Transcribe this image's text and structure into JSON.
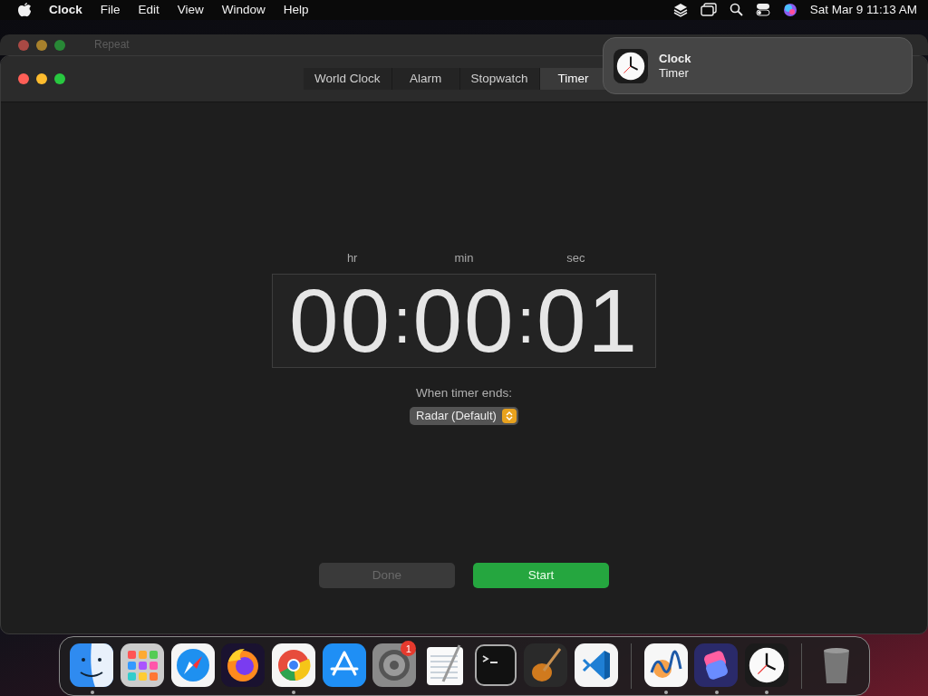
{
  "menu_bar": {
    "app": "Clock",
    "items": [
      "File",
      "Edit",
      "View",
      "Window",
      "Help"
    ],
    "clock": "Sat Mar 9  11:13 AM"
  },
  "back_window": {
    "title": "Repeat"
  },
  "tabs": [
    {
      "label": "World Clock",
      "selected": false
    },
    {
      "label": "Alarm",
      "selected": false
    },
    {
      "label": "Stopwatch",
      "selected": false
    },
    {
      "label": "Timer",
      "selected": true
    }
  ],
  "timer": {
    "separator": ":",
    "fields": [
      {
        "label": "hr",
        "value": "00"
      },
      {
        "label": "min",
        "value": "00"
      },
      {
        "label": "sec",
        "value": "01"
      }
    ]
  },
  "sound": {
    "label": "When timer ends:",
    "value": "Radar (Default)"
  },
  "buttons": [
    {
      "label": "Done",
      "disabled": true,
      "kind": "secondary"
    },
    {
      "label": "Start",
      "disabled": false,
      "kind": "primary"
    }
  ],
  "notification": {
    "title": "Clock",
    "body": "Timer"
  },
  "dock": [
    {
      "kind": "finder",
      "running": true
    },
    {
      "kind": "launchpad",
      "running": false
    },
    {
      "kind": "safari",
      "running": false
    },
    {
      "kind": "firefox",
      "running": false
    },
    {
      "kind": "chrome",
      "running": true
    },
    {
      "kind": "appstore",
      "running": false
    },
    {
      "kind": "settings",
      "running": false,
      "badge": "1"
    },
    {
      "kind": "textedit",
      "running": false
    },
    {
      "kind": "terminal",
      "running": false
    },
    {
      "kind": "garageband",
      "running": false
    },
    {
      "kind": "vscode",
      "running": false
    },
    {
      "kind": "divider"
    },
    {
      "kind": "freeform",
      "running": true
    },
    {
      "kind": "shortcuts",
      "running": true
    },
    {
      "kind": "clock",
      "running": true
    },
    {
      "kind": "divider"
    },
    {
      "kind": "trash",
      "running": false
    }
  ]
}
